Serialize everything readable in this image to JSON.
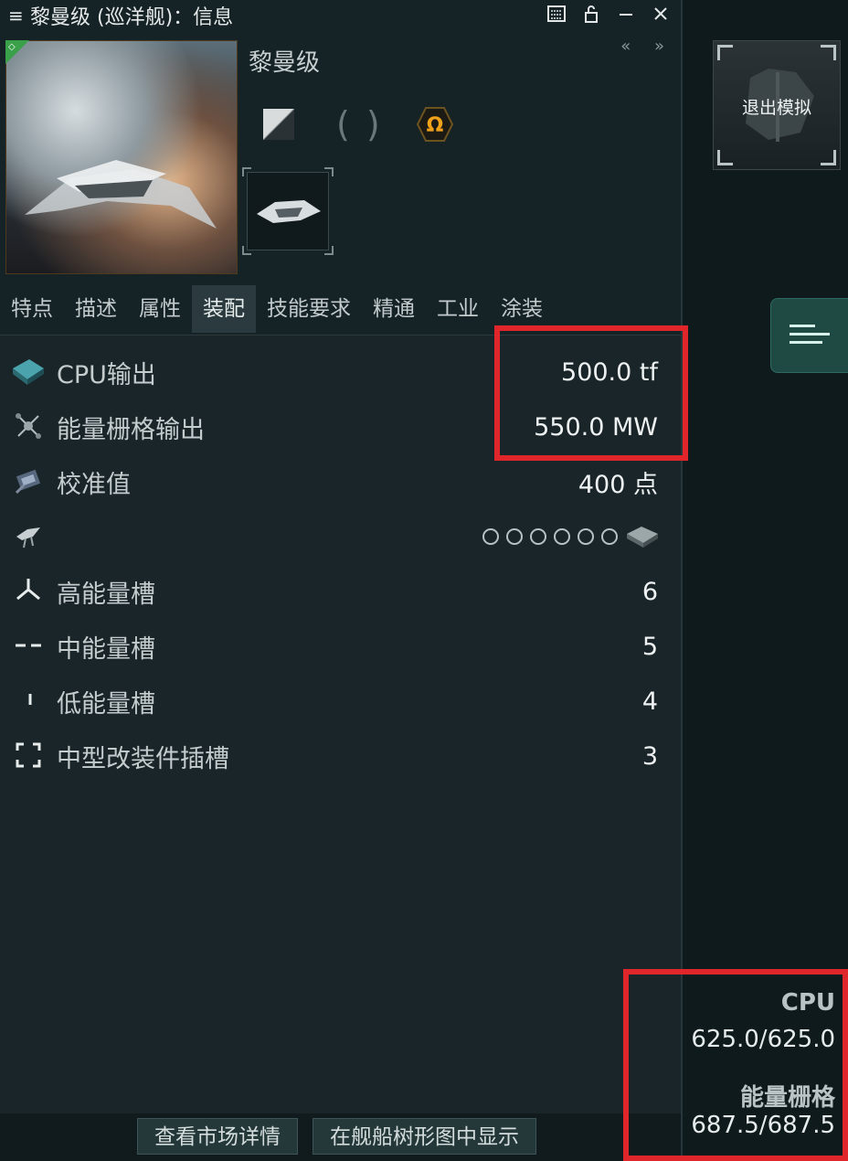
{
  "window": {
    "title": "黎曼级 (巡洋舰)：信息",
    "menu_glyph": "≡"
  },
  "ship": {
    "name": "黎曼级",
    "collapse_glyph": "« »"
  },
  "tabs": [
    "特点",
    "描述",
    "属性",
    "装配",
    "技能要求",
    "精通",
    "工业",
    "涂装"
  ],
  "active_tab": "装配",
  "attributes": [
    {
      "label": "CPU输出",
      "value": "500.0 tf"
    },
    {
      "label": "能量栅格输出",
      "value": "550.0 MW"
    },
    {
      "label": "校准值",
      "value": "400 点"
    },
    {
      "label": "",
      "value": ""
    },
    {
      "label": "高能量槽",
      "value": "6"
    },
    {
      "label": "中能量槽",
      "value": "5"
    },
    {
      "label": "低能量槽",
      "value": "4"
    },
    {
      "label": "中型改装件插槽",
      "value": "3"
    }
  ],
  "footer": {
    "market_button": "查看市场详情",
    "tree_button": "在舰船树形图中显示"
  },
  "side": {
    "exit_sim_label": "退出模拟",
    "cpu_label": "CPU",
    "cpu_value": "625.0/625.0",
    "grid_label": "能量栅格",
    "grid_value": "687.5/687.5"
  },
  "colors": {
    "highlight": "#e0262b",
    "accent_green": "#1f4a44",
    "omega_gold": "#f0a21a"
  },
  "icons": [
    "menu-icon",
    "minimize-icon",
    "lock-icon",
    "close-icon",
    "omega-icon",
    "cpu-icon",
    "powergrid-icon",
    "calibration-icon",
    "drone-icon",
    "high-slot-icon",
    "mid-slot-icon",
    "low-slot-icon",
    "rig-slot-icon",
    "hamburger-icon"
  ]
}
